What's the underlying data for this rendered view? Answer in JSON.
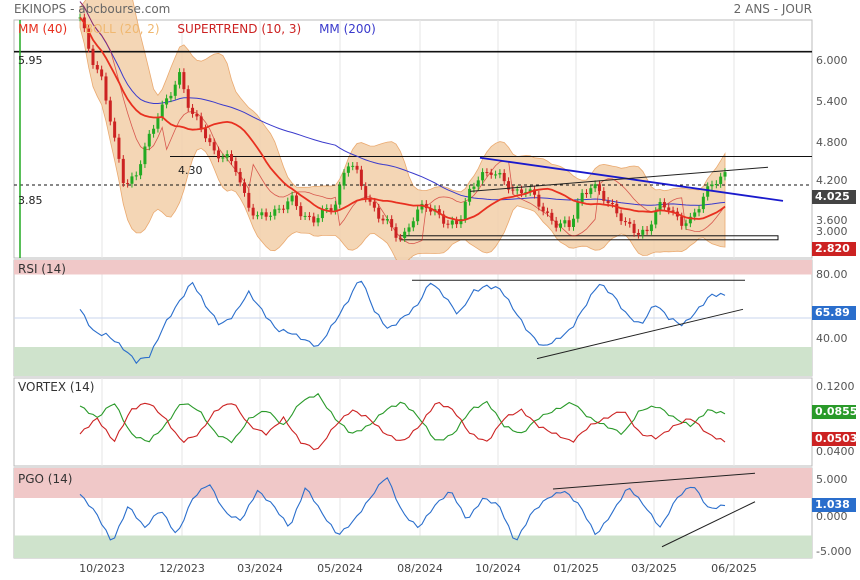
{
  "header": {
    "left": "EKINOPS - abcbourse.com",
    "right": "2 ANS - JOUR"
  },
  "legend": {
    "mm40": "MM (40)",
    "boll": "BOLL (20, 2)",
    "supertrend": "SUPERTREND (10, 3)",
    "mm200": "MM (200)"
  },
  "colors": {
    "price_up": "#22aa22",
    "price_down": "#cc2222",
    "mm40": "#e83020",
    "boll_fill": "#f3d2ad",
    "boll_line": "#e8a060",
    "supertrend": "#cc2222",
    "mm200": "#3a3acc",
    "trend_blue": "#1a1acc",
    "rsi_over": "#f0c8c8",
    "rsi_under": "#cfe3cc",
    "vortex_plus": "#2a9a2a",
    "vortex_minus": "#cc2222",
    "osc_line": "#2a6ecc"
  },
  "chart_data": [
    {
      "type": "candlestick",
      "title": "EKINOPS",
      "period": "2 ANS - JOUR",
      "y_ticks": [
        "6.000",
        "5.400",
        "4.800",
        "4.200",
        "3.600",
        "3.000"
      ],
      "ylim": [
        2.7,
        6.45
      ],
      "x_labels": [
        "10/2023",
        "12/2023",
        "03/2024",
        "05/2024",
        "08/2024",
        "10/2024",
        "01/2025",
        "03/2025",
        "06/2025"
      ],
      "levels": [
        {
          "label": "5.95",
          "value": 5.95
        },
        {
          "label": "4.30",
          "value": 4.3
        },
        {
          "label": "3.85",
          "value": 3.85
        }
      ],
      "last_value": "4.025",
      "supertrend_value": "2.820",
      "series": [
        {
          "name": "MM (40)"
        },
        {
          "name": "BOLL (20, 2)"
        },
        {
          "name": "SUPERTREND (10, 3)"
        },
        {
          "name": "MM (200)"
        }
      ],
      "close": [
        6.45,
        5.9,
        5.5,
        4.6,
        3.9,
        3.95,
        4.5,
        5.0,
        5.2,
        5.6,
        5.0,
        4.7,
        4.4,
        4.3,
        4.1,
        3.6,
        3.3,
        3.4,
        3.5,
        3.6,
        3.4,
        3.3,
        3.4,
        3.6,
        4.2,
        4.0,
        3.6,
        3.3,
        3.2,
        3.0,
        3.3,
        3.6,
        3.4,
        3.2,
        3.3,
        3.7,
        4.0,
        4.1,
        3.9,
        3.75,
        3.8,
        3.6,
        3.4,
        3.2,
        3.2,
        3.7,
        3.8,
        3.7,
        3.5,
        3.2,
        3.15,
        3.1,
        3.5,
        3.55,
        3.2,
        3.3,
        3.7,
        3.85,
        4.02
      ]
    },
    {
      "type": "line",
      "title": "RSI (14)",
      "y_ticks": [
        "80.00",
        "40.00"
      ],
      "ylim": [
        10,
        90
      ],
      "bands": [
        80,
        30
      ],
      "last_value": "65.89",
      "values": [
        56,
        40,
        38,
        30,
        20,
        24,
        45,
        60,
        75,
        58,
        45,
        52,
        68,
        55,
        42,
        40,
        35,
        30,
        45,
        60,
        78,
        55,
        42,
        50,
        58,
        75,
        65,
        52,
        68,
        72,
        70,
        55,
        40,
        30,
        35,
        42,
        58,
        74,
        66,
        52,
        45,
        60,
        50,
        45,
        55,
        66,
        65.89
      ]
    },
    {
      "type": "line",
      "title": "VORTEX (14)",
      "y_ticks": [
        "0.1200",
        "0.0400"
      ],
      "ylim": [
        0.02,
        0.13
      ],
      "last_value_plus": "0.0855",
      "last_value_minus": "0.0503",
      "series": [
        {
          "values": [
            0.095,
            0.08,
            0.1,
            0.06,
            0.05,
            0.07,
            0.1,
            0.09,
            0.06,
            0.05,
            0.08,
            0.09,
            0.07,
            0.1,
            0.11,
            0.08,
            0.06,
            0.07,
            0.09,
            0.1,
            0.08,
            0.05,
            0.06,
            0.09,
            0.1,
            0.07,
            0.06,
            0.08,
            0.09,
            0.1,
            0.08,
            0.07,
            0.06,
            0.09,
            0.095,
            0.08,
            0.07,
            0.09,
            0.0855
          ]
        },
        {
          "values": [
            0.06,
            0.08,
            0.05,
            0.09,
            0.1,
            0.08,
            0.05,
            0.06,
            0.09,
            0.1,
            0.07,
            0.06,
            0.08,
            0.05,
            0.04,
            0.07,
            0.09,
            0.08,
            0.06,
            0.05,
            0.07,
            0.1,
            0.09,
            0.06,
            0.05,
            0.08,
            0.09,
            0.07,
            0.06,
            0.05,
            0.07,
            0.08,
            0.09,
            0.06,
            0.055,
            0.07,
            0.08,
            0.06,
            0.0503
          ]
        }
      ]
    },
    {
      "type": "line",
      "title": "PGO (14)",
      "y_ticks": [
        "5.000",
        "0.000",
        "-5.000"
      ],
      "ylim": [
        -6,
        6
      ],
      "bands": [
        2,
        -3
      ],
      "last_value": "1.038",
      "values": [
        2.5,
        0,
        -4,
        1,
        -2,
        0.5,
        -3,
        2,
        4,
        0,
        -1,
        3,
        1,
        -2,
        3.5,
        0,
        -3,
        -1,
        2,
        5,
        0,
        -2,
        1,
        3,
        -1,
        2,
        1,
        -4,
        0,
        2,
        3,
        1,
        -3,
        0,
        3.5,
        1,
        -2,
        2,
        3.8,
        0.5,
        1.038
      ]
    }
  ]
}
